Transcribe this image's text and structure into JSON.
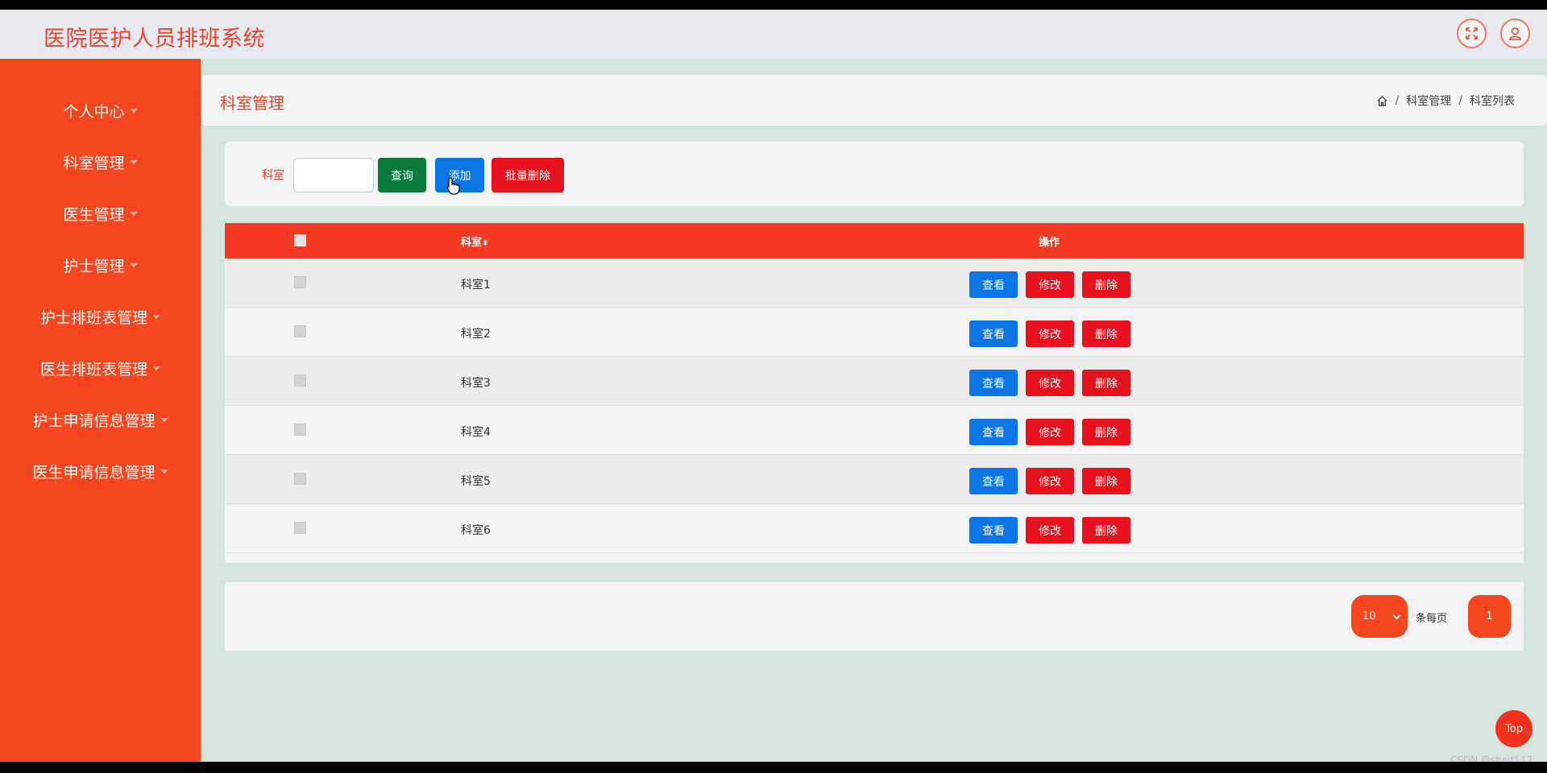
{
  "header": {
    "title": "医院医护人员排班系统",
    "fullscreen_icon": "expand-icon",
    "user_icon": "user-icon"
  },
  "sidebar": {
    "items": [
      {
        "label": "个人中心"
      },
      {
        "label": "科室管理"
      },
      {
        "label": "医生管理"
      },
      {
        "label": "护士管理"
      },
      {
        "label": "护士排班表管理"
      },
      {
        "label": "医生排班表管理"
      },
      {
        "label": "护士申请信息管理"
      },
      {
        "label": "医生申请信息管理"
      }
    ]
  },
  "page": {
    "title": "科室管理",
    "breadcrumb": [
      "科室管理",
      "科室列表"
    ]
  },
  "search": {
    "label": "科室",
    "value": "",
    "query_label": "查询",
    "add_label": "添加",
    "batch_delete_label": "批量删除"
  },
  "table": {
    "columns": [
      "科室",
      "操作"
    ],
    "rows": [
      {
        "name": "科室1"
      },
      {
        "name": "科室2"
      },
      {
        "name": "科室3"
      },
      {
        "name": "科室4"
      },
      {
        "name": "科室5"
      },
      {
        "name": "科室6"
      }
    ],
    "actions": {
      "view": "查看",
      "edit": "修改",
      "delete": "删除"
    }
  },
  "pagination": {
    "page_size": "10",
    "per_page_label": "条每页",
    "current_page": "1"
  },
  "top_button": "Top",
  "watermark": "CSDN @shejt117",
  "colors": {
    "primary": "#f5461f",
    "table_header": "#f43a22",
    "query": "#0a7a3a",
    "view": "#0b75e6",
    "danger": "#e8121e"
  }
}
